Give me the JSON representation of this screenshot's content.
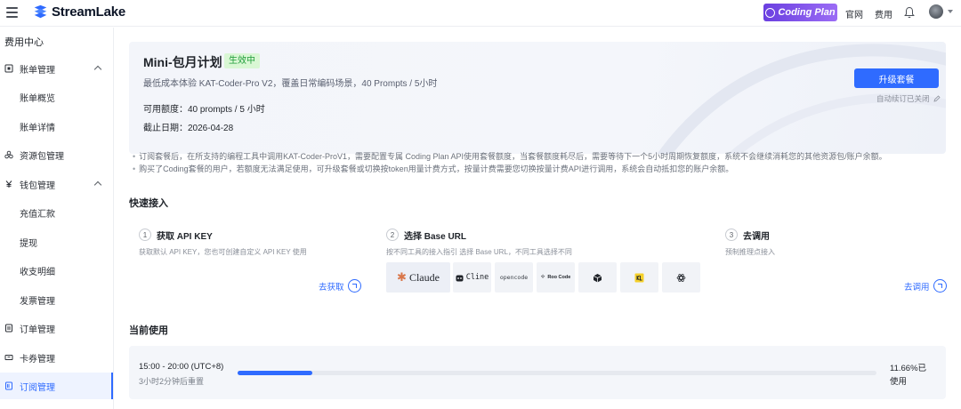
{
  "topbar": {
    "brand": "StreamLake",
    "coding_plan": "Coding Plan",
    "links": [
      "官网",
      "费用"
    ]
  },
  "sidebar": {
    "title": "费用中心",
    "items": [
      {
        "label": "账单管理",
        "icon": "bill-icon",
        "expandable": true
      },
      {
        "label": "账单概览",
        "sub": true
      },
      {
        "label": "账单详情",
        "sub": true
      },
      {
        "label": "资源包管理",
        "icon": "resource-icon"
      },
      {
        "label": "钱包管理",
        "icon": "wallet-icon",
        "expandable": true
      },
      {
        "label": "充值汇款",
        "sub": true
      },
      {
        "label": "提现",
        "sub": true
      },
      {
        "label": "收支明细",
        "sub": true
      },
      {
        "label": "发票管理",
        "sub": true
      },
      {
        "label": "订单管理",
        "icon": "order-icon"
      },
      {
        "label": "卡券管理",
        "icon": "coupon-icon"
      },
      {
        "label": "订阅管理",
        "icon": "subscription-icon",
        "active": true
      }
    ]
  },
  "plan": {
    "name": "Mini-包月计划",
    "status": "生效中",
    "description": "最低成本体验 KAT-Coder-Pro V2，覆盖日常编码场景，40 Prompts / 5小时",
    "quota": "可用额度：40 prompts / 5 小时",
    "expire": "截止日期：2026-04-28",
    "upgrade_label": "升级套餐",
    "auto_renew": "自动续订已关闭"
  },
  "notes": [
    "订阅套餐后，在所支持的编程工具中调用KAT-Coder-ProV1，需要配置专属 Coding Plan API使用套餐额度，当套餐额度耗尽后，需要等待下一个5小时周期恢复额度，系统不会继续消耗您的其他资源包/账户余额。",
    "购买了Coding套餐的用户，若额度无法满足使用，可升级套餐或切换按token用量计费方式，按量计费需要您切换按量计费API进行调用，系统会自动抵扣您的账户余额。"
  ],
  "quick_access": {
    "title": "快速接入",
    "steps": [
      {
        "num": "1",
        "title": "获取 API KEY",
        "desc": "获取默认 API KEY，您也可创建自定义 API KEY 使用",
        "link": "去获取"
      },
      {
        "num": "2",
        "title": "选择 Base URL",
        "desc": "按不同工具的接入指引 选择 Base URL，不同工具选择不同"
      },
      {
        "num": "3",
        "title": "去调用",
        "desc": "预制推理点接入",
        "link": "去调用"
      }
    ],
    "tools": [
      "Claude",
      "Cline",
      "opencode",
      "Roo Code",
      "",
      "",
      ""
    ]
  },
  "usage": {
    "title": "当前使用",
    "window": "15:00 - 20:00 (UTC+8)",
    "reset": "3小时2分钟后重置",
    "percent": 11.66,
    "percent_label": "11.66%已使用"
  }
}
